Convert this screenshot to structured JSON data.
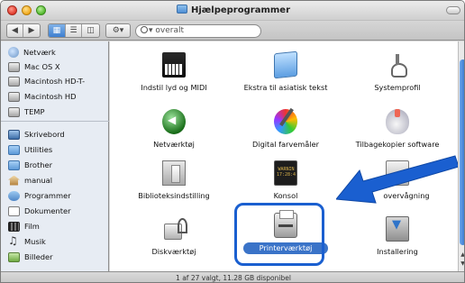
{
  "window": {
    "title": "Hjælpeprogrammer"
  },
  "toolbar": {
    "search_placeholder": "overalt"
  },
  "sidebar": {
    "devices": [
      {
        "label": "Netværk",
        "icon": "network-globe-icon"
      },
      {
        "label": "Mac OS X",
        "icon": "hard-disk-icon"
      },
      {
        "label": "Macintosh HD-T-",
        "icon": "hard-disk-icon"
      },
      {
        "label": "Macintosh HD",
        "icon": "hard-disk-icon"
      },
      {
        "label": "TEMP",
        "icon": "hard-disk-icon"
      }
    ],
    "places": [
      {
        "label": "Skrivebord",
        "icon": "desktop-icon"
      },
      {
        "label": "Utilities",
        "icon": "folder-icon"
      },
      {
        "label": "Brother",
        "icon": "folder-icon"
      },
      {
        "label": "manual",
        "icon": "home-icon"
      },
      {
        "label": "Programmer",
        "icon": "applications-icon"
      },
      {
        "label": "Dokumenter",
        "icon": "documents-icon"
      },
      {
        "label": "Film",
        "icon": "film-icon"
      },
      {
        "label": "Musik",
        "icon": "music-icon"
      },
      {
        "label": "Billeder",
        "icon": "pictures-icon"
      }
    ]
  },
  "content": {
    "items": [
      {
        "label": "Indstil lyd og MIDI",
        "icon": "audio-midi-setup-icon"
      },
      {
        "label": "Ekstra til asiatisk tekst",
        "icon": "folder-icon"
      },
      {
        "label": "Systemprofil",
        "icon": "system-profiler-icon"
      },
      {
        "label": "Netværktøj",
        "icon": "network-utility-icon"
      },
      {
        "label": "Digital farvemåler",
        "icon": "color-meter-icon"
      },
      {
        "label": "Tilbagekopier software",
        "icon": "backup-icon"
      },
      {
        "label": "Biblioteksindstilling",
        "icon": "directory-utility-icon"
      },
      {
        "label": "Konsol",
        "icon": "console-icon"
      },
      {
        "label": "overvågning",
        "icon": "activity-monitor-icon"
      },
      {
        "label": "Diskværktøj",
        "icon": "disk-utility-icon"
      },
      {
        "label": "Printerværktøj",
        "icon": "printer-setup-utility-icon",
        "selected": true
      },
      {
        "label": "Installering",
        "icon": "installer-icon"
      }
    ]
  },
  "status": {
    "text": "1 af 27 valgt, 11.28 GB disponibel"
  },
  "colors": {
    "selection": "#3a73c8",
    "callout": "#1a5fd0"
  }
}
